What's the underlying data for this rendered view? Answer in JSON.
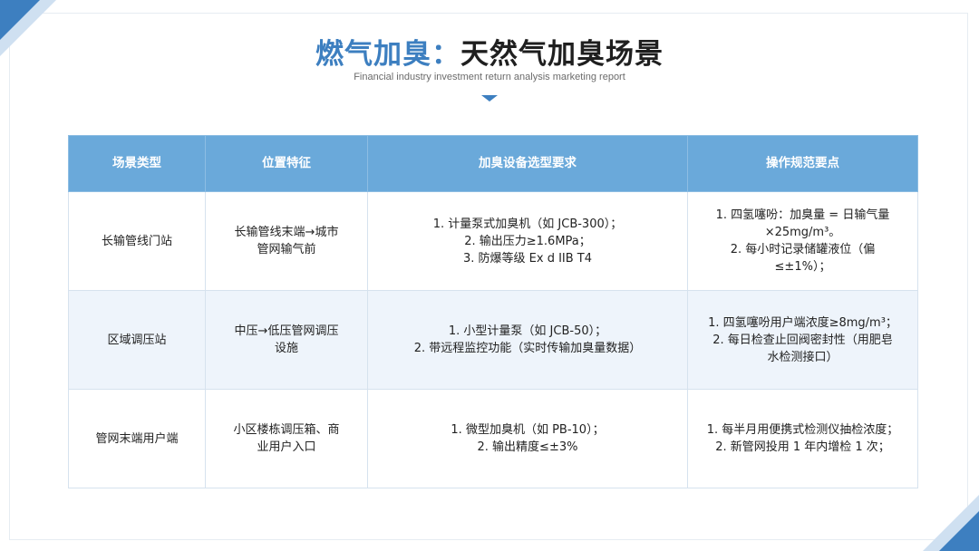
{
  "title": {
    "highlight": "燃气加臭：",
    "main": "天然气加臭场景"
  },
  "subtitle": "Financial industry investment return analysis marketing report",
  "table": {
    "headers": [
      "场景类型",
      "位置特征",
      "加臭设备选型要求",
      "操作规范要点"
    ],
    "rows": [
      {
        "scene": "长输管线门站",
        "location": [
          "长输管线末端→城市",
          "管网输气前"
        ],
        "equipment": [
          "1. 计量泵式加臭机（如 JCB-300）；",
          "2. 输出压力≥1.6MPa；",
          "3. 防爆等级 Ex d IIB T4"
        ],
        "operation": [
          "1. 四氢噻吩：加臭量 = 日输气量",
          "×25mg/m³。",
          "2. 每小时记录储罐液位（偏",
          "≤±1%）；"
        ]
      },
      {
        "scene": "区域调压站",
        "location": [
          "中压→低压管网调压",
          "设施"
        ],
        "equipment": [
          "1. 小型计量泵（如 JCB-50）；",
          "2. 带远程监控功能（实时传输加臭量数据）"
        ],
        "operation": [
          "1. 四氢噻吩用户端浓度≥8mg/m³；",
          "2. 每日检查止回阀密封性（用肥皂",
          "水检测接口）"
        ]
      },
      {
        "scene": "管网末端用户端",
        "location": [
          "小区楼栋调压箱、商",
          "业用户入口"
        ],
        "equipment": [
          "1. 微型加臭机（如 PB-10）；",
          "2. 输出精度≤±3%"
        ],
        "operation": [
          "1. 每半月用便携式检测仪抽检浓度；",
          "2. 新管网投用 1 年内增检 1 次；"
        ]
      }
    ]
  },
  "colors": {
    "accent": "#3d7fc0",
    "header_bg": "#6aa9da",
    "alt_row_bg": "#eef4fb"
  }
}
